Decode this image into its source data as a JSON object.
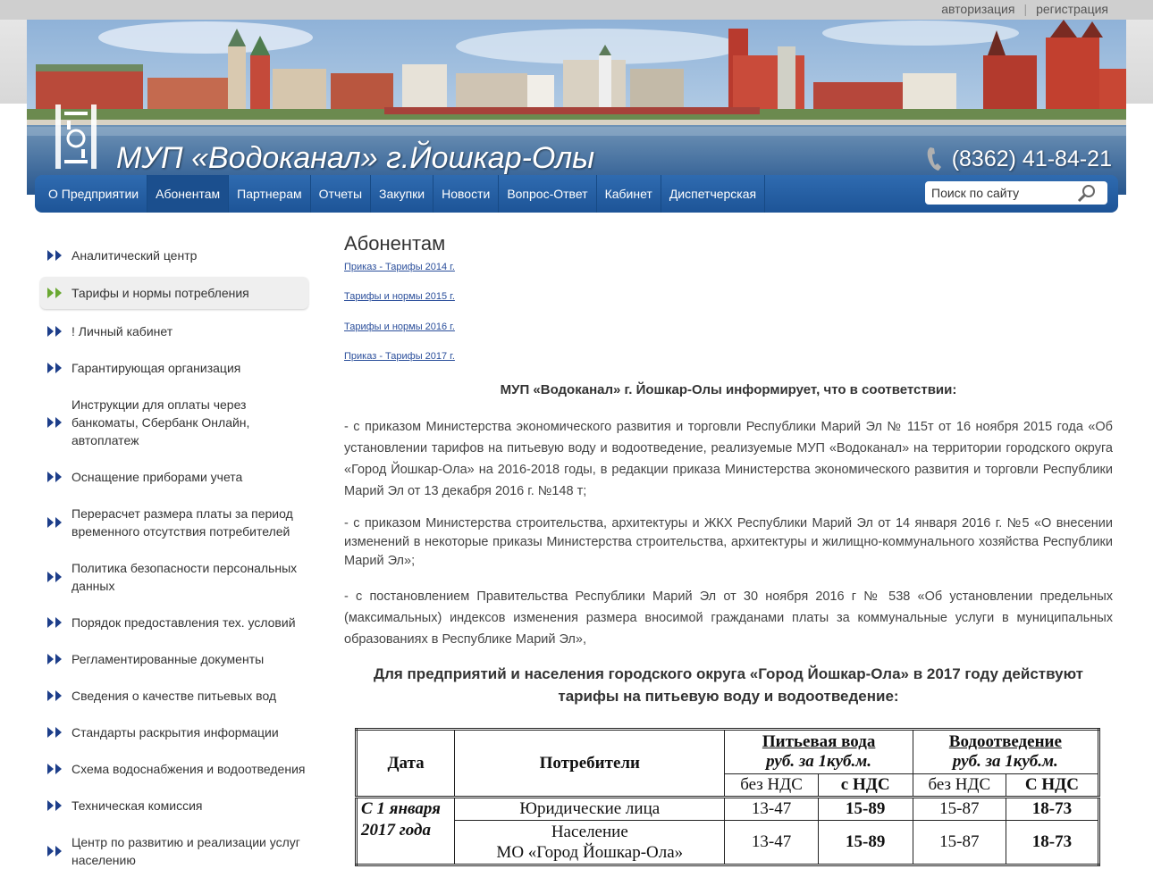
{
  "auth": {
    "login": "авторизация",
    "register": "регистрация"
  },
  "header": {
    "title": "МУП «Водоканал» г.Йошкар-Олы",
    "phone": "(8362) 41-84-21",
    "logo_text": "МУП Водоканал Йошкар-Ола"
  },
  "nav": {
    "items": [
      {
        "label": "О Предприятии"
      },
      {
        "label": "Абонентам"
      },
      {
        "label": "Партнерам"
      },
      {
        "label": "Отчеты"
      },
      {
        "label": "Закупки"
      },
      {
        "label": "Новости"
      },
      {
        "label": "Вопрос-Ответ"
      },
      {
        "label": "Кабинет"
      },
      {
        "label": "Диспетчерская"
      }
    ],
    "active_index": 1,
    "search_placeholder": "Поиск по сайту"
  },
  "sidebar": {
    "items": [
      {
        "label": "Аналитический центр"
      },
      {
        "label": "Тарифы и нормы потребления"
      },
      {
        "label": "! Личный кабинет"
      },
      {
        "label": "Гарантирующая организация"
      },
      {
        "label": "Инструкции для оплаты через банкоматы, Сбербанк Онлайн, автоплатеж"
      },
      {
        "label": "Оснащение приборами учета"
      },
      {
        "label": "Перерасчет размера платы за период временного отсутствия потребителей"
      },
      {
        "label": "Политика безопасности персональных данных"
      },
      {
        "label": "Порядок предоставления тех. условий"
      },
      {
        "label": "Регламентированные документы"
      },
      {
        "label": "Сведения о качестве питьевых вод"
      },
      {
        "label": "Стандарты раскрытия информации"
      },
      {
        "label": "Схема водоснабжения и водоотведения"
      },
      {
        "label": "Техническая комиссия"
      },
      {
        "label": "Центр по развитию и реализации услуг населению"
      }
    ],
    "active_index": 1
  },
  "main": {
    "title": "Абонентам",
    "links": [
      "Приказ - Тарифы 2014 г.",
      "Тарифы и нормы 2015 г.",
      "Тарифы и нормы 2016 г.",
      "Приказ - Тарифы 2017 г."
    ],
    "info_heading": "МУП «Водоканал» г. Йошкар-Олы информирует, что в соответствии:",
    "paragraphs": [
      "- с приказом Министерства экономического развития и торговли Республики Марий Эл № 115т от 16 ноября 2015 года «Об установлении тарифов на питьевую воду и водоотведение, реализуемые МУП «Водоканал» на территории городского округа «Город Йошкар-Ола» на 2016-2018 годы, в редакции приказа Министерства экономического развития и торговли Республики Марий Эл от 13 декабря 2016 г. №148 т;",
      "- с приказом Министерства строительства, архитектуры и ЖКХ Республики Марий Эл от 14 января 2016 г. №5 «О внесении изменений в некоторые приказы Министерства строительства, архитектуры и жилищно-коммунального хозяйства Республики Марий Эл»;",
      "- с постановлением Правительства Республики Марий Эл от 30 ноября 2016 г № 538 «Об установлении предельных (максимальных) индексов изменения размера вносимой гражданами платы за коммунальные услуги в муниципальных образованиях в Республике Марий Эл»,"
    ],
    "tariff_heading_1": "Для предприятий и населения городского округа «Город Йошкар-Ола» в 2017 году действуют",
    "tariff_heading_2": "тарифы на питьевую воду и водоотведение:"
  },
  "tariff_table": {
    "col_date": "Дата",
    "col_consumers": "Потребители",
    "water": {
      "title": "Питьевая вода",
      "unit": "руб. за 1куб.м.",
      "no_vat": "без НДС",
      "with_vat": "с НДС"
    },
    "sewage": {
      "title": "Водоотведение",
      "unit": "руб. за 1куб.м.",
      "no_vat": "без НДС",
      "with_vat": "С НДС"
    },
    "period_line1": "С 1 января",
    "period_line2": "2017 года",
    "rows": [
      {
        "consumer_line1": "Юридические лица",
        "consumer_line2": "",
        "water_no_vat": "13-47",
        "water_vat": "15-89",
        "sewage_no_vat": "15-87",
        "sewage_vat": "18-73"
      },
      {
        "consumer_line1": "Население",
        "consumer_line2": "МО «Город Йошкар-Ола»",
        "water_no_vat": "13-47",
        "water_vat": "15-89",
        "sewage_no_vat": "15-87",
        "sewage_vat": "18-73"
      }
    ]
  }
}
